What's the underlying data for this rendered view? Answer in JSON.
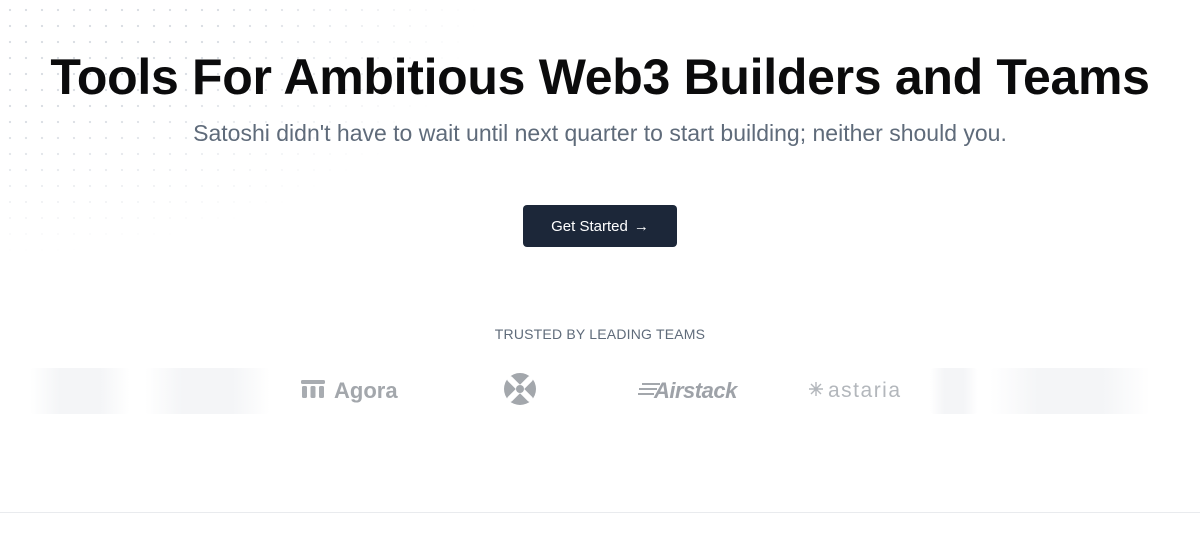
{
  "hero": {
    "title": "Tools For Ambitious Web3 Builders and Teams",
    "subtitle": "Satoshi didn't have to wait until next quarter to start building; neither should you.",
    "cta_label": "Get Started",
    "cta_icon": "arrow-right-icon"
  },
  "trusted": {
    "label": "TRUSTED BY LEADING TEAMS",
    "logos": [
      {
        "name": "Agora",
        "icon": "agora-logo-icon"
      },
      {
        "name": "",
        "icon": "x-circle-logo-icon"
      },
      {
        "name": "Airstack",
        "icon": "airstack-logo-icon"
      },
      {
        "name": "astaria",
        "icon": "astaria-star-icon"
      }
    ]
  },
  "colors": {
    "cta_background": "#1c2739",
    "title": "#0b0b0c",
    "subtitle": "#5f6b7a",
    "logo_gray": "#a4a8ad"
  }
}
